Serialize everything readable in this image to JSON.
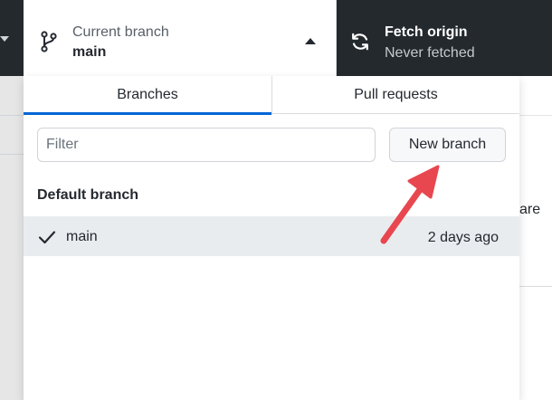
{
  "toolbar": {
    "current_branch": {
      "caption": "Current branch",
      "value": "main",
      "icon": "git-branch-icon"
    },
    "fetch": {
      "caption": "Fetch origin",
      "value": "Never fetched",
      "icon": "sync-icon"
    }
  },
  "dropdown": {
    "tabs": [
      {
        "label": "Branches",
        "active": true
      },
      {
        "label": "Pull requests",
        "active": false
      }
    ],
    "filter": {
      "placeholder": "Filter",
      "value": ""
    },
    "new_branch_label": "New branch",
    "sections": [
      {
        "header": "Default branch",
        "branches": [
          {
            "name": "main",
            "checked": true,
            "time": "2 days ago"
          }
        ]
      }
    ]
  },
  "background": {
    "partial_text": "are"
  },
  "colors": {
    "accent": "#0366d6",
    "toolbar_bg": "#24292e",
    "annotation_arrow": "#e8474f"
  }
}
